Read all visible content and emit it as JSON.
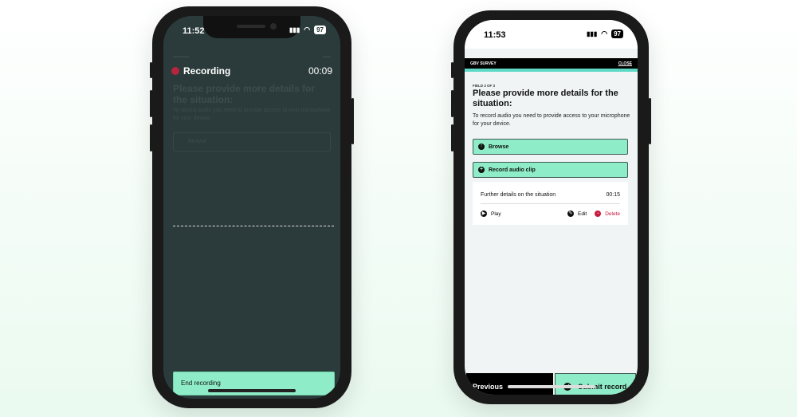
{
  "left_phone": {
    "status": {
      "time": "11:52",
      "battery": "97"
    },
    "recording": {
      "title": "Recording",
      "timer": "00:09"
    },
    "ghost": {
      "question": "Please provide more details for the situation:",
      "body": "To record audio you need to provide access to your microphone for your device.",
      "browse": "Browse"
    },
    "end_button": "End recording"
  },
  "right_phone": {
    "status": {
      "time": "11:53",
      "battery": "97"
    },
    "app_bar": {
      "title": "GBV SURVEY",
      "close": "CLOSE"
    },
    "field_number": "FIELD 3 OF 3",
    "question": "Please provide more details for the situation:",
    "body": "To record audio you need to provide access to your microphone for your device.",
    "browse_button": "Browse",
    "record_button": "Record audio clip",
    "clip": {
      "name": "Further details on the situation",
      "duration": "00:15",
      "play": "Play",
      "edit": "Edit",
      "delete": "Delete"
    },
    "previous_button": "Previous",
    "submit_button": "Submit record"
  },
  "colors": {
    "accent_green": "#8eedc8",
    "teal_bar": "#5ed9c5",
    "recording_red": "#b7243d",
    "delete_red": "#c8193c",
    "dark_bg": "#2b3b3b"
  }
}
